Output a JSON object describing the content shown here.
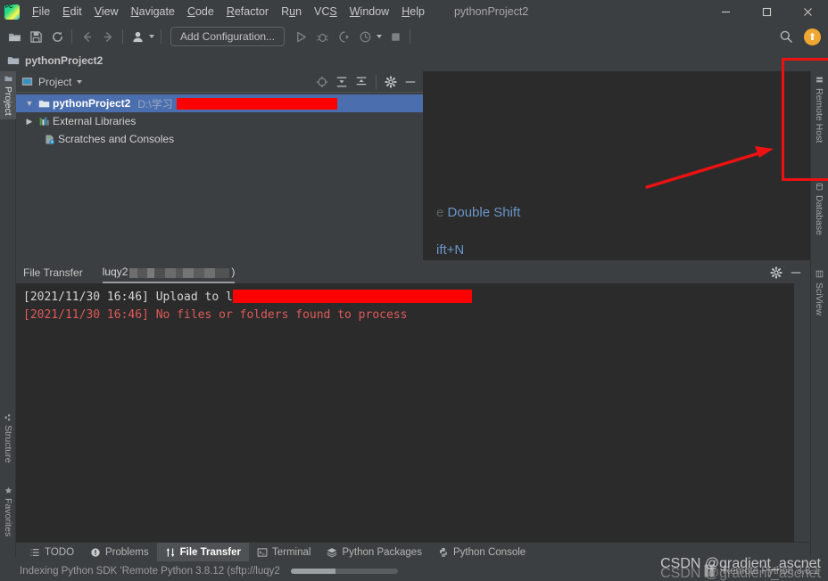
{
  "window": {
    "title": "pythonProject2",
    "controls": {
      "minimize": "—",
      "maximize": "☐",
      "close": "✕"
    }
  },
  "menu": {
    "items": [
      {
        "label": "File",
        "mnemonic": "F"
      },
      {
        "label": "Edit",
        "mnemonic": "E"
      },
      {
        "label": "View",
        "mnemonic": "V"
      },
      {
        "label": "Navigate",
        "mnemonic": "N"
      },
      {
        "label": "Code",
        "mnemonic": "C"
      },
      {
        "label": "Refactor",
        "mnemonic": "R"
      },
      {
        "label": "Run",
        "mnemonic": "u"
      },
      {
        "label": "VCS",
        "mnemonic": "S"
      },
      {
        "label": "Window",
        "mnemonic": "W"
      },
      {
        "label": "Help",
        "mnemonic": "H"
      }
    ]
  },
  "toolbar": {
    "open_tooltip": "Open",
    "save_tooltip": "Save All",
    "sync_tooltip": "Synchronize",
    "back_tooltip": "Back",
    "forward_tooltip": "Forward",
    "profile_tooltip": "Switch Profile",
    "add_configuration": "Add Configuration...",
    "run_tooltip": "Run",
    "debug_tooltip": "Debug",
    "coverage_tooltip": "Run with Coverage",
    "profiler_tooltip": "Profile",
    "stop_tooltip": "Stop",
    "search_tooltip": "Search Everywhere",
    "update_badge": "⬆"
  },
  "breadcrumb": {
    "project": "pythonProject2"
  },
  "left_strip": {
    "tabs": [
      {
        "label": "Project",
        "active": true
      },
      {
        "label": "Structure",
        "active": false
      },
      {
        "label": "Favorites",
        "active": false
      }
    ]
  },
  "right_strip": {
    "tabs": [
      {
        "label": "Remote Host"
      },
      {
        "label": "Database"
      },
      {
        "label": "SciView"
      }
    ]
  },
  "project_panel": {
    "title": "Project",
    "icons": {
      "locate": "select-opened-file-icon",
      "expand": "expand-all-icon",
      "collapse": "collapse-all-icon",
      "settings": "gear-icon",
      "hide": "hide-icon"
    },
    "tree": [
      {
        "label": "pythonProject2",
        "path": "D:\\学习",
        "redacted": true,
        "expanded": true,
        "selected": true,
        "icon": "folder-icon",
        "indent": 0
      },
      {
        "label": "External Libraries",
        "path": "",
        "redacted": false,
        "expanded": false,
        "selected": false,
        "icon": "library-icon",
        "indent": 0
      },
      {
        "label": "Scratches and Consoles",
        "path": "",
        "redacted": false,
        "expanded": null,
        "selected": false,
        "icon": "scratches-icon",
        "indent": 1
      }
    ]
  },
  "editor": {
    "hint_search_prefix": "e",
    "hint_search": "Double Shift",
    "hint_goto": "ift+N"
  },
  "file_transfer": {
    "title": "File Transfer",
    "tab_label": "luqy2",
    "tab_suffix": ")",
    "gear_icon": "gear-icon",
    "hide_icon": "hide-icon",
    "log": [
      {
        "text": "[2021/11/30 16:46] Upload to l",
        "level": "info",
        "redacted": true
      },
      {
        "text": "[2021/11/30 16:46] No files or folders found to process",
        "level": "error",
        "redacted": false
      }
    ]
  },
  "bottom_tabs": [
    {
      "label": "TODO",
      "icon": "todo-icon",
      "active": false
    },
    {
      "label": "Problems",
      "icon": "problems-icon",
      "active": false
    },
    {
      "label": "File Transfer",
      "icon": "file-transfer-icon",
      "active": true
    },
    {
      "label": "Terminal",
      "icon": "terminal-icon",
      "active": false
    },
    {
      "label": "Python Packages",
      "icon": "packages-icon",
      "active": false
    },
    {
      "label": "Python Console",
      "icon": "python-console-icon",
      "active": false
    }
  ],
  "status_bar": {
    "message": "Indexing Python SDK 'Remote Python 3.8.12 (sftp://luqy2",
    "progress": 42,
    "interpreter": "Remote Python 3.8.1"
  },
  "annotations": {
    "highlight_target": "Remote Host",
    "rect_color": "#ee1111",
    "arrow_color": "#ee1111"
  },
  "watermark": {
    "text": "CSDN @gradient_ascnet"
  },
  "colors": {
    "chrome": "#3c3f41",
    "editor_bg": "#2b2b2b",
    "selection": "#4b6eaf",
    "accent_link": "#6a96c9",
    "error": "#e05a5a",
    "redaction": "#ff0000",
    "update": "#f0a732"
  }
}
